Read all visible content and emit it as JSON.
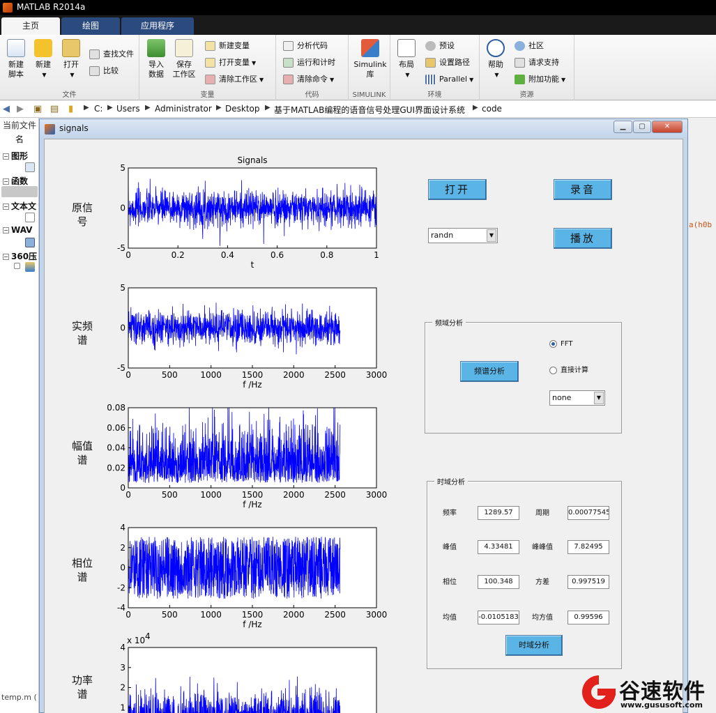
{
  "app": {
    "title": "MATLAB R2014a"
  },
  "tabs": [
    "主页",
    "绘图",
    "应用程序"
  ],
  "ribbon": {
    "file": {
      "label": "文件",
      "new_script": "新建\n脚本",
      "new": "新建",
      "open": "打开",
      "find_files": "查找文件",
      "compare": "比较"
    },
    "variable": {
      "label": "变量",
      "import": "导入\n数据",
      "save_ws": "保存\n工作区",
      "new_var": "新建变量",
      "open_var": "打开变量",
      "clear_ws": "清除工作区"
    },
    "code": {
      "label": "代码",
      "analyze": "分析代码",
      "run_time": "运行和计时",
      "clear_cmd": "清除命令"
    },
    "simulink": {
      "label": "SIMULINK",
      "lib": "Simulink\n库"
    },
    "env": {
      "label": "环境",
      "layout": "布局",
      "prefs": "预设",
      "set_path": "设置路径",
      "parallel": "Parallel"
    },
    "resources": {
      "label": "资源",
      "help": "帮助",
      "community": "社区",
      "support": "请求支持",
      "addons": "附加功能"
    }
  },
  "address": [
    "C:",
    "Users",
    "Administrator",
    "Desktop",
    "基于MATLAB编程的语音信号处理GUI界面设计系统",
    "code"
  ],
  "left_panel": {
    "title": "当前文件",
    "col": "名",
    "items": [
      "图形",
      "函数",
      "文本文",
      "WAV",
      "360压"
    ],
    "bottom": "temp.m ("
  },
  "right_code": "a(h0b",
  "figure": {
    "title": "signals",
    "controls": {
      "open": "打开",
      "record": "录音",
      "play": "播放",
      "signal_type": "randn",
      "freq_panel": {
        "title": "频域分析",
        "analyze": "频谱分析",
        "fft": "FFT",
        "direct": "直接计算",
        "window": "none"
      },
      "time_panel": {
        "title": "时域分析",
        "freq_label": "频率",
        "freq": "1289.57",
        "period_label": "周期",
        "period": "0.00077545",
        "peak_label": "峰值",
        "peak": "4.33481",
        "p2p_label": "峰峰值",
        "p2p": "7.82495",
        "phase_label": "相位",
        "phase": "100.348",
        "var_label": "方差",
        "var": "0.997519",
        "mean_label": "均值",
        "mean": "-0.0105183",
        "rms_label": "均方值",
        "rms": "0.99596",
        "analyze": "时域分析"
      }
    }
  },
  "chart_data": [
    {
      "type": "line",
      "title": "Signals",
      "ylabel": "原信号",
      "xlabel": "t",
      "xlim": [
        0,
        1
      ],
      "ylim": [
        -5,
        5
      ],
      "xticks": [
        "0",
        "0.2",
        "0.4",
        "0.6",
        "0.8",
        "1"
      ],
      "yticks": [
        "5",
        "0",
        "-5"
      ],
      "x_end": 1,
      "amplitude": 1.7,
      "color": "#0000ff"
    },
    {
      "type": "line",
      "ylabel": "实频谱",
      "xlabel": "f /Hz",
      "xlim": [
        0,
        3000
      ],
      "ylim": [
        -5,
        5
      ],
      "xticks": [
        "0",
        "500",
        "1000",
        "1500",
        "2000",
        "2500",
        "3000"
      ],
      "yticks": [
        "5",
        "0",
        "-5"
      ],
      "x_end": 2560,
      "amplitude": 1.6,
      "color": "#0000ff"
    },
    {
      "type": "line",
      "ylabel": "幅值谱",
      "xlabel": "f /Hz",
      "xlim": [
        0,
        3000
      ],
      "ylim": [
        0,
        0.08
      ],
      "xticks": [
        "0",
        "500",
        "1000",
        "1500",
        "2000",
        "2500",
        "3000"
      ],
      "yticks": [
        "0.08",
        "0.06",
        "0.04",
        "0.02",
        "0"
      ],
      "x_end": 2560,
      "amplitude": 0.03,
      "color": "#0000ff"
    },
    {
      "type": "line",
      "ylabel": "相位谱",
      "xlabel": "f /Hz",
      "xlim": [
        0,
        3000
      ],
      "ylim": [
        -4,
        4
      ],
      "xticks": [
        "0",
        "500",
        "1000",
        "1500",
        "2000",
        "2500",
        "3000"
      ],
      "yticks": [
        "4",
        "2",
        "0",
        "-2",
        "-4"
      ],
      "x_end": 2560,
      "amplitude": 3.1,
      "color": "#0000ff"
    },
    {
      "type": "line",
      "ylabel": "功率谱",
      "xlabel": "",
      "xlim": [
        0,
        3000
      ],
      "ylim": [
        0,
        40000
      ],
      "xticks": [],
      "yticks": [
        "4",
        "3",
        "2",
        "1"
      ],
      "yscale_label": "x 10",
      "yscale_exp": "4",
      "x_end": 2560,
      "amplitude": 12000,
      "color": "#0000ff"
    }
  ],
  "watermark": {
    "brand": "谷速软件",
    "url": "www.gususoft.com"
  }
}
